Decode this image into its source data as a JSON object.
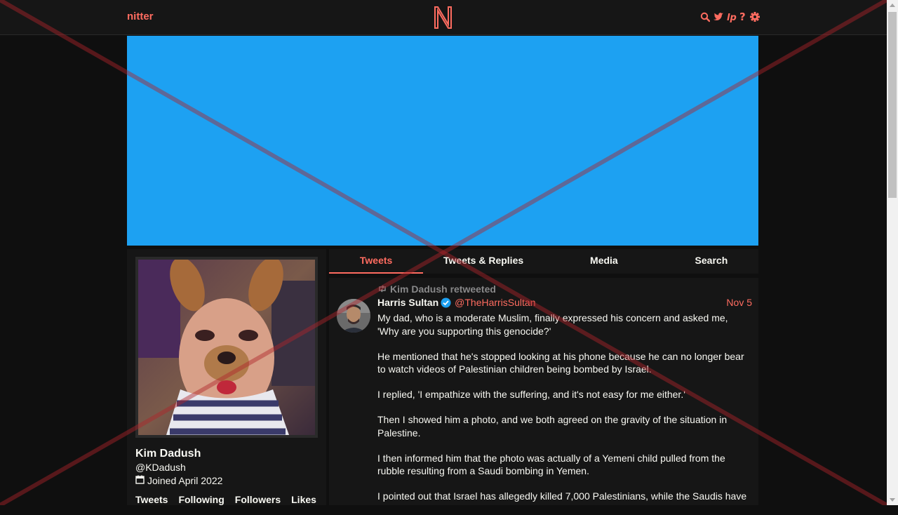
{
  "navbar": {
    "brand": "nitter",
    "logo_letter": "N",
    "icons": [
      "search-icon",
      "twitter-bird-icon",
      "rss-icon",
      "help-icon",
      "settings-gear-icon"
    ]
  },
  "colors": {
    "accent": "#ff6c60",
    "banner": "#1da1f2",
    "background": "#0f0f0f",
    "panel": "#161616",
    "muted": "#888889"
  },
  "profile": {
    "fullname": "Kim Dadush",
    "username": "@KDadush",
    "joined": "Joined April 2022",
    "stats": [
      "Tweets",
      "Following",
      "Followers",
      "Likes"
    ]
  },
  "tabs": [
    "Tweets",
    "Tweets & Replies",
    "Media",
    "Search"
  ],
  "active_tab": "Tweets",
  "tweet": {
    "retweet_header": "Kim Dadush retweeted",
    "fullname": "Harris Sultan",
    "username": "@TheHarrisSultan",
    "date": "Nov 5",
    "paragraphs": [
      "My dad, who is a moderate Muslim, finally expressed his concern and asked me, 'Why are you supporting this genocide?'",
      "He mentioned that he's stopped looking at his phone because he can no longer bear to watch videos of Palestinian children being bombed by Israel.",
      "I replied, 'I empathize with the suffering, and it's not easy for me either.'",
      "Then I showed him a photo, and we both agreed on the gravity of the situation in Palestine.",
      "I then informed him that the photo was actually of a Yemeni child pulled from the rubble resulting from a Saudi bombing in Yemen.",
      "I pointed out that Israel has allegedly killed 7,000 Palestinians, while the Saudis have"
    ]
  }
}
